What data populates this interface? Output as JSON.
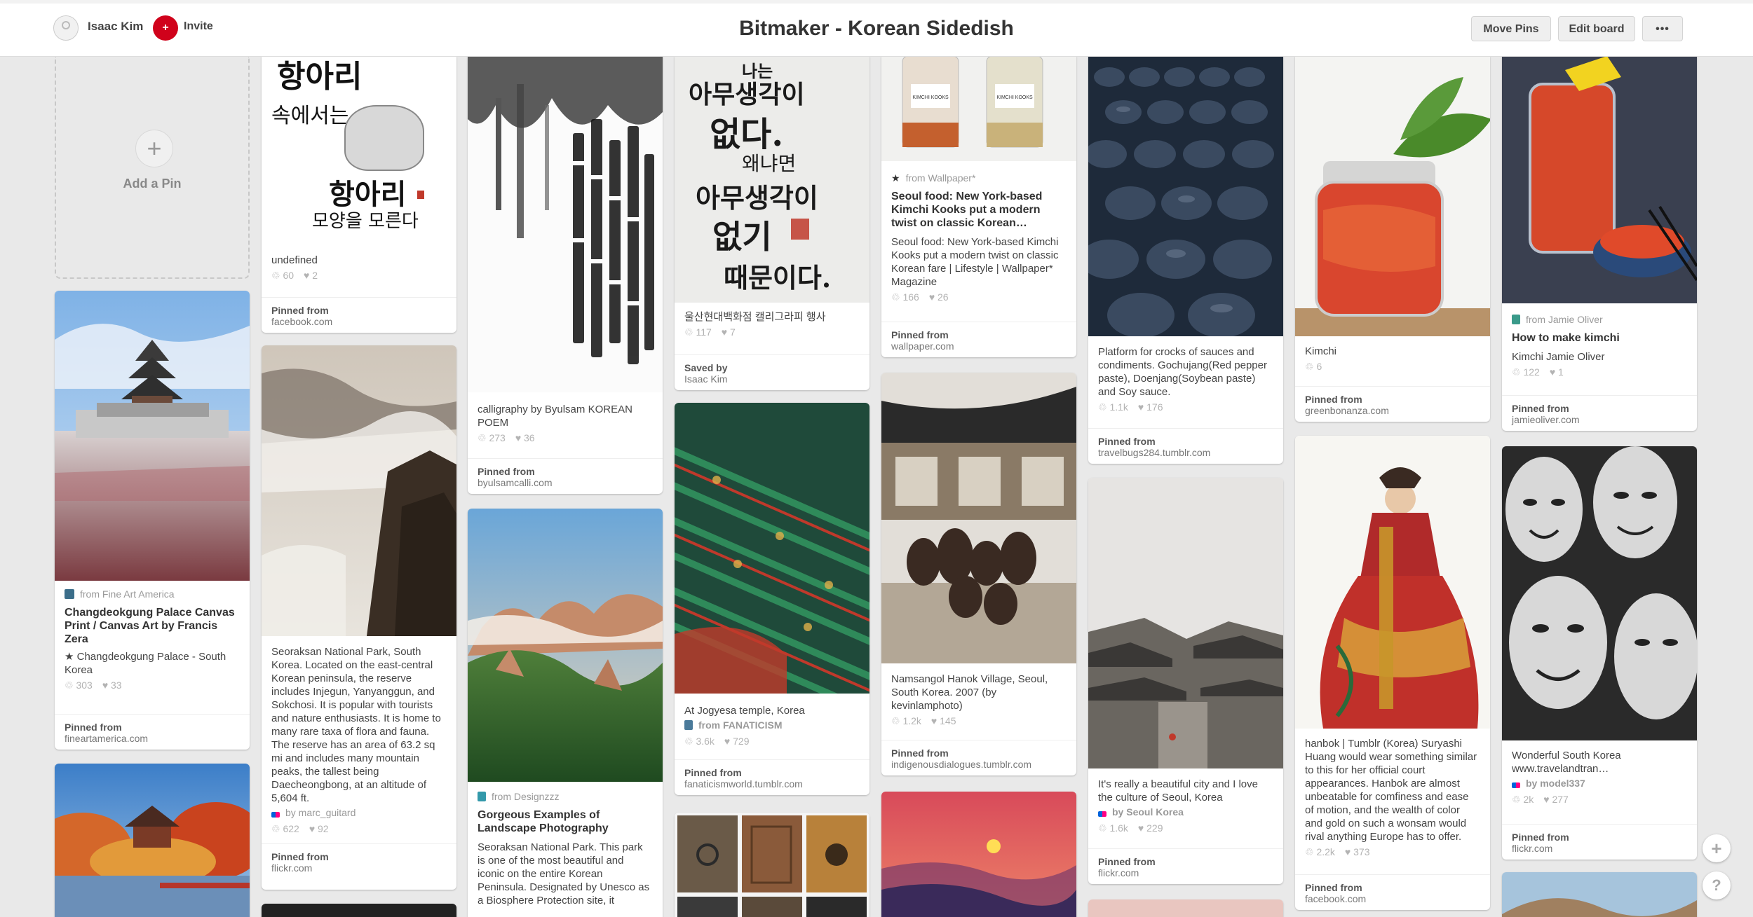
{
  "header": {
    "user_name": "Isaac Kim",
    "invite_label": "Invite",
    "board_title": "Bitmaker - Korean Sidedish",
    "move_pins_label": "Move Pins",
    "edit_board_label": "Edit board",
    "more_label": "•••"
  },
  "add_pin_label": "Add a Pin",
  "pins": {
    "calligraphy1": {
      "desc": "undefined",
      "repins": "60",
      "likes": "2",
      "pinned_label": "Pinned from",
      "pinned_value": "facebook.com"
    },
    "calligraphy2": {
      "desc": "calligraphy by Byulsam KOREAN POEM",
      "repins": "273",
      "likes": "36",
      "pinned_label": "Pinned from",
      "pinned_value": "byulsamcalli.com"
    },
    "calligraphy3": {
      "desc": "울산현대백화점 캘리그라피 행사",
      "repins": "117",
      "likes": "7",
      "pinned_label": "Saved by",
      "pinned_value": "Isaac Kim"
    },
    "kimchi_kooks": {
      "source": "from Wallpaper*",
      "title": "Seoul food: New York-based Kimchi Kooks put a modern twist on classic Korean…",
      "desc": "Seoul food: New York-based Kimchi Kooks put a modern twist on classic Korean fare | Lifestyle | Wallpaper* Magazine",
      "repins": "166",
      "likes": "26",
      "pinned_label": "Pinned from",
      "pinned_value": "wallpaper.com"
    },
    "crocks": {
      "desc": "Platform for crocks of sauces and condiments. Gochujang(Red pepper paste), Doenjang(Soybean paste) and Soy sauce.",
      "repins": "1.1k",
      "likes": "176",
      "pinned_label": "Pinned from",
      "pinned_value": "travelbugs284.tumblr.com"
    },
    "kimchi_jar": {
      "desc": "Kimchi",
      "repins": "6",
      "pinned_label": "Pinned from",
      "pinned_value": "greenbonanza.com"
    },
    "jamie_kimchi": {
      "source": "from Jamie Oliver",
      "title": "How to make kimchi",
      "desc": "Kimchi Jamie Oliver",
      "repins": "122",
      "likes": "1",
      "pinned_label": "Pinned from",
      "pinned_value": "jamieoliver.com"
    },
    "palace": {
      "source": "from Fine Art America",
      "title": "Changdeokgung Palace Canvas Print / Canvas Art by Francis Zera",
      "desc": "★ Changdeokgung Palace - South Korea",
      "repins": "303",
      "likes": "33",
      "pinned_label": "Pinned from",
      "pinned_value": "fineartamerica.com"
    },
    "seoraksan": {
      "desc": "Seoraksan National Park, South Korea. Located on the east-central Korean peninsula, the reserve includes Injegun, Yanyanggun, and Sokchosi. It is popular with tourists and nature enthusiasts. It is home to many rare taxa of flora and fauna. The reserve has an area of 63.2 sq mi and includes many mountain peaks, the tallest being Daecheongbong, at an altitude of 5,604 ft.",
      "by": "by marc_guitard",
      "repins": "622",
      "likes": "92",
      "pinned_label": "Pinned from",
      "pinned_value": "flickr.com"
    },
    "landscape": {
      "source": "from Designzzz",
      "title": "Gorgeous Examples of Landscape Photography",
      "desc": "Seoraksan National Park. This park is one of the most beautiful and iconic on the entire Korean Peninsula. Designated by Unesco as a Biosphere Protection site, it"
    },
    "jogyesa": {
      "desc": "At Jogyesa temple, Korea",
      "by": "from FANATICISM",
      "repins": "3.6k",
      "likes": "729",
      "pinned_label": "Pinned from",
      "pinned_value": "fanaticismworld.tumblr.com"
    },
    "namsangol": {
      "desc": "Namsangol Hanok Village, Seoul, South Korea. 2007 (by kevinlamphoto)",
      "repins": "1.2k",
      "likes": "145",
      "pinned_label": "Pinned from",
      "pinned_value": "indigenousdialogues.tumblr.com"
    },
    "seoul_city": {
      "desc": "It's really a beautiful city and I love the culture of Seoul, Korea",
      "by": "by Seoul Korea",
      "repins": "1.6k",
      "likes": "229",
      "pinned_label": "Pinned from",
      "pinned_value": "flickr.com"
    },
    "hanbok": {
      "desc": "hanbok | Tumblr (Korea) Suryashi Huang would wear something similar to this for her official court appearances. Hanbok are almost unbeatable for comfiness and ease of motion, and the wealth of color and gold on such a wonsam would rival anything Europe has to offer.",
      "repins": "2.2k",
      "likes": "373",
      "pinned_label": "Pinned from",
      "pinned_value": "facebook.com"
    },
    "masks": {
      "desc": "Wonderful South Korea www.travelandtran…",
      "by": "by model337",
      "repins": "2k",
      "likes": "277",
      "pinned_label": "Pinned from",
      "pinned_value": "flickr.com"
    }
  },
  "calligraphy_text": {
    "c1_line1": "항아리",
    "c1_line2": "속에서는",
    "c1_line3": "항아리",
    "c1_line4": "모양을 모른다",
    "c3_line1": "나는",
    "c3_line2": "아무생각이",
    "c3_line3": "없다.",
    "c3_line4": "왜냐면",
    "c3_line5": "아무생각이",
    "c3_line6": "없기",
    "c3_line7": "때문이다.",
    "jar_label_a": "KIMCHI KOOKS",
    "jar_label_b": "KIMCHI KOOKS"
  },
  "float_buttons": {
    "add": "+",
    "help": "?"
  },
  "colors": {
    "accent_red": "#d0021b",
    "background": "#e9e9e9"
  }
}
